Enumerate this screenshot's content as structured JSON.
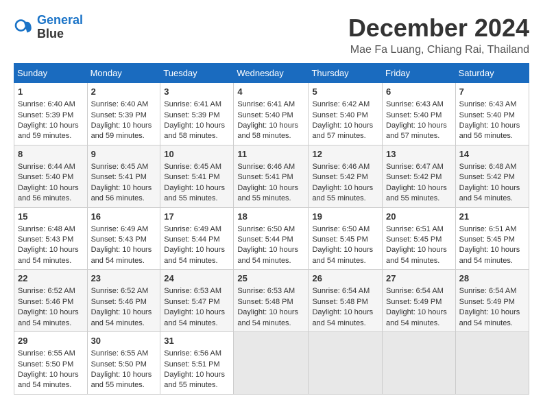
{
  "logo": {
    "line1": "General",
    "line2": "Blue"
  },
  "title": "December 2024",
  "location": "Mae Fa Luang, Chiang Rai, Thailand",
  "days_of_week": [
    "Sunday",
    "Monday",
    "Tuesday",
    "Wednesday",
    "Thursday",
    "Friday",
    "Saturday"
  ],
  "weeks": [
    [
      {
        "day": "1",
        "sunrise": "6:40 AM",
        "sunset": "5:39 PM",
        "daylight": "10 hours and 59 minutes."
      },
      {
        "day": "2",
        "sunrise": "6:40 AM",
        "sunset": "5:39 PM",
        "daylight": "10 hours and 59 minutes."
      },
      {
        "day": "3",
        "sunrise": "6:41 AM",
        "sunset": "5:39 PM",
        "daylight": "10 hours and 58 minutes."
      },
      {
        "day": "4",
        "sunrise": "6:41 AM",
        "sunset": "5:40 PM",
        "daylight": "10 hours and 58 minutes."
      },
      {
        "day": "5",
        "sunrise": "6:42 AM",
        "sunset": "5:40 PM",
        "daylight": "10 hours and 57 minutes."
      },
      {
        "day": "6",
        "sunrise": "6:43 AM",
        "sunset": "5:40 PM",
        "daylight": "10 hours and 57 minutes."
      },
      {
        "day": "7",
        "sunrise": "6:43 AM",
        "sunset": "5:40 PM",
        "daylight": "10 hours and 56 minutes."
      }
    ],
    [
      {
        "day": "8",
        "sunrise": "6:44 AM",
        "sunset": "5:40 PM",
        "daylight": "10 hours and 56 minutes."
      },
      {
        "day": "9",
        "sunrise": "6:45 AM",
        "sunset": "5:41 PM",
        "daylight": "10 hours and 56 minutes."
      },
      {
        "day": "10",
        "sunrise": "6:45 AM",
        "sunset": "5:41 PM",
        "daylight": "10 hours and 55 minutes."
      },
      {
        "day": "11",
        "sunrise": "6:46 AM",
        "sunset": "5:41 PM",
        "daylight": "10 hours and 55 minutes."
      },
      {
        "day": "12",
        "sunrise": "6:46 AM",
        "sunset": "5:42 PM",
        "daylight": "10 hours and 55 minutes."
      },
      {
        "day": "13",
        "sunrise": "6:47 AM",
        "sunset": "5:42 PM",
        "daylight": "10 hours and 55 minutes."
      },
      {
        "day": "14",
        "sunrise": "6:48 AM",
        "sunset": "5:42 PM",
        "daylight": "10 hours and 54 minutes."
      }
    ],
    [
      {
        "day": "15",
        "sunrise": "6:48 AM",
        "sunset": "5:43 PM",
        "daylight": "10 hours and 54 minutes."
      },
      {
        "day": "16",
        "sunrise": "6:49 AM",
        "sunset": "5:43 PM",
        "daylight": "10 hours and 54 minutes."
      },
      {
        "day": "17",
        "sunrise": "6:49 AM",
        "sunset": "5:44 PM",
        "daylight": "10 hours and 54 minutes."
      },
      {
        "day": "18",
        "sunrise": "6:50 AM",
        "sunset": "5:44 PM",
        "daylight": "10 hours and 54 minutes."
      },
      {
        "day": "19",
        "sunrise": "6:50 AM",
        "sunset": "5:45 PM",
        "daylight": "10 hours and 54 minutes."
      },
      {
        "day": "20",
        "sunrise": "6:51 AM",
        "sunset": "5:45 PM",
        "daylight": "10 hours and 54 minutes."
      },
      {
        "day": "21",
        "sunrise": "6:51 AM",
        "sunset": "5:45 PM",
        "daylight": "10 hours and 54 minutes."
      }
    ],
    [
      {
        "day": "22",
        "sunrise": "6:52 AM",
        "sunset": "5:46 PM",
        "daylight": "10 hours and 54 minutes."
      },
      {
        "day": "23",
        "sunrise": "6:52 AM",
        "sunset": "5:46 PM",
        "daylight": "10 hours and 54 minutes."
      },
      {
        "day": "24",
        "sunrise": "6:53 AM",
        "sunset": "5:47 PM",
        "daylight": "10 hours and 54 minutes."
      },
      {
        "day": "25",
        "sunrise": "6:53 AM",
        "sunset": "5:48 PM",
        "daylight": "10 hours and 54 minutes."
      },
      {
        "day": "26",
        "sunrise": "6:54 AM",
        "sunset": "5:48 PM",
        "daylight": "10 hours and 54 minutes."
      },
      {
        "day": "27",
        "sunrise": "6:54 AM",
        "sunset": "5:49 PM",
        "daylight": "10 hours and 54 minutes."
      },
      {
        "day": "28",
        "sunrise": "6:54 AM",
        "sunset": "5:49 PM",
        "daylight": "10 hours and 54 minutes."
      }
    ],
    [
      {
        "day": "29",
        "sunrise": "6:55 AM",
        "sunset": "5:50 PM",
        "daylight": "10 hours and 54 minutes."
      },
      {
        "day": "30",
        "sunrise": "6:55 AM",
        "sunset": "5:50 PM",
        "daylight": "10 hours and 55 minutes."
      },
      {
        "day": "31",
        "sunrise": "6:56 AM",
        "sunset": "5:51 PM",
        "daylight": "10 hours and 55 minutes."
      },
      null,
      null,
      null,
      null
    ]
  ]
}
